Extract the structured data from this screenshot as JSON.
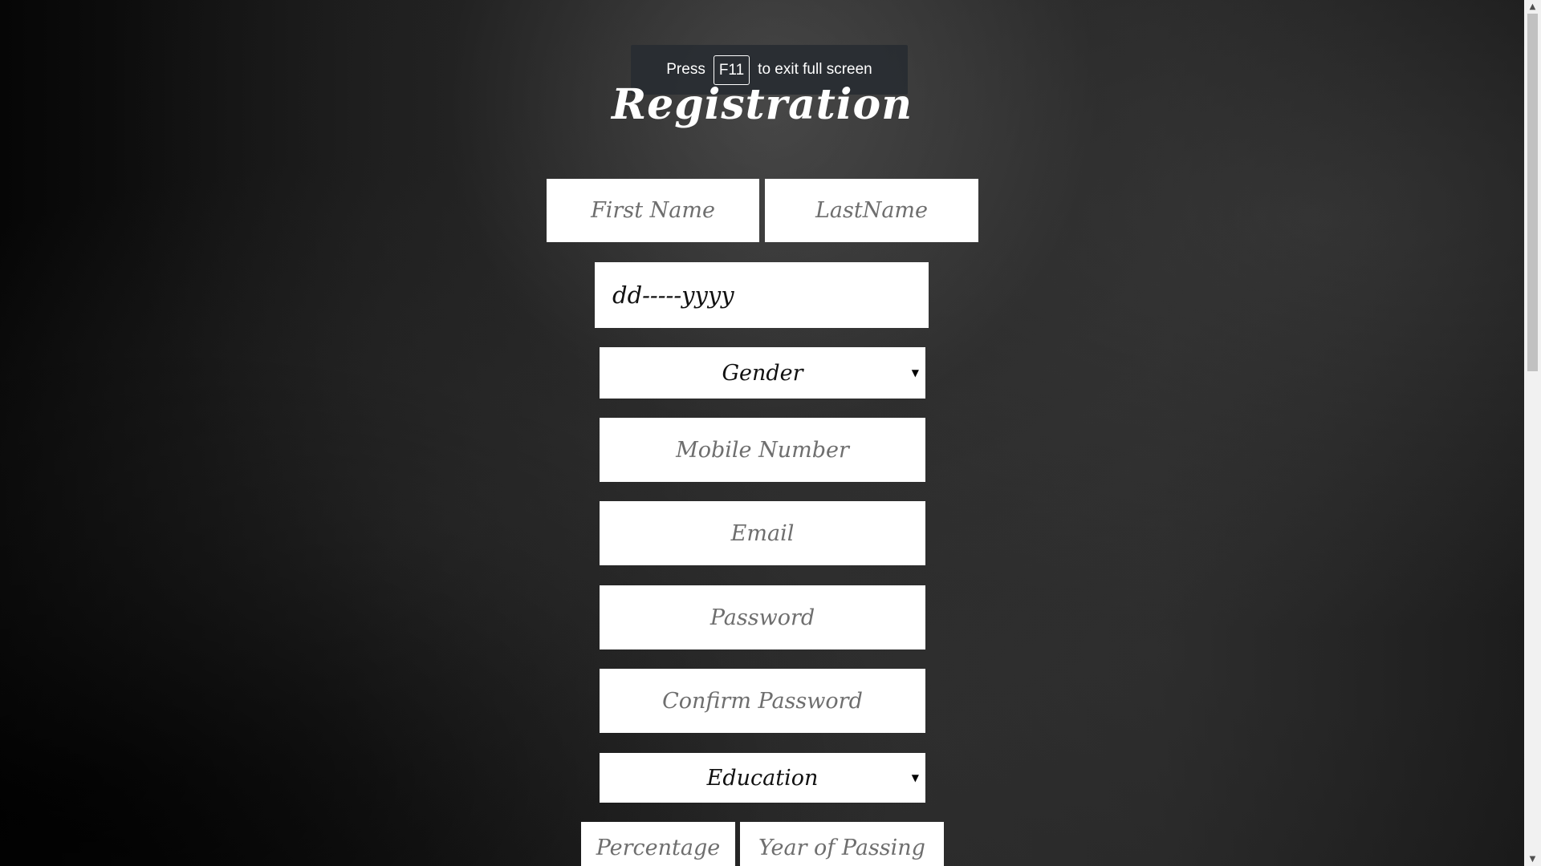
{
  "fullscreen_notice": {
    "press": "Press",
    "key": "F11",
    "rest": "to exit full screen"
  },
  "form": {
    "title": "Registration",
    "first_name": {
      "placeholder": "First Name",
      "value": ""
    },
    "last_name": {
      "placeholder": "LastName",
      "value": ""
    },
    "dob": {
      "display": "dd-----yyyy"
    },
    "gender": {
      "selected": "Gender"
    },
    "mobile": {
      "placeholder": "Mobile Number",
      "value": ""
    },
    "email": {
      "placeholder": "Email",
      "value": ""
    },
    "password": {
      "placeholder": "Password",
      "value": ""
    },
    "confirm_password": {
      "placeholder": "Confirm Password",
      "value": ""
    },
    "education": {
      "selected": "Education"
    },
    "percentage": {
      "placeholder": "Percentage",
      "value": ""
    },
    "year_of_passing": {
      "placeholder": "Year of Passing",
      "value": ""
    }
  },
  "icons": {
    "select_caret": "caret-down-icon",
    "scroll_up": "scroll-up-arrow-icon",
    "scroll_down": "scroll-down-arrow-icon"
  },
  "scrollbar": {
    "position_fraction": 0.0,
    "visible_fraction": 0.42
  }
}
